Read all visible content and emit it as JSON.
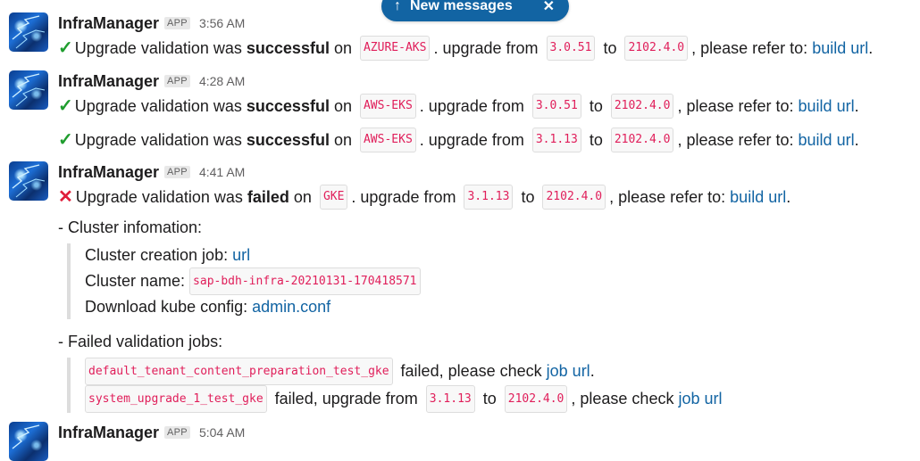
{
  "banner": {
    "label": "New messages",
    "arrow": "↑",
    "close": "✕"
  },
  "messages": [
    {
      "sender": "InfraManager",
      "badge": "APP",
      "time": "3:56 AM",
      "lines": [
        {
          "icon": "✓",
          "pre": "Upgrade validation was ",
          "bold": "successful",
          "on": " on ",
          "platform": "AZURE-AKS",
          "mid": ". upgrade from ",
          "from": "3.0.51",
          "to_word": " to ",
          "to": "2102.4.0",
          "post": ", please refer to: ",
          "link": "build url",
          "end": "."
        }
      ]
    },
    {
      "sender": "InfraManager",
      "badge": "APP",
      "time": "4:28 AM",
      "lines": [
        {
          "icon": "✓",
          "pre": "Upgrade validation was ",
          "bold": "successful",
          "on": " on ",
          "platform": "AWS-EKS",
          "mid": ". upgrade from ",
          "from": "3.0.51",
          "to_word": " to ",
          "to": "2102.4.0",
          "post": ", please refer to: ",
          "link": "build url",
          "end": "."
        },
        {
          "icon": "✓",
          "pre": "Upgrade validation was ",
          "bold": "successful",
          "on": " on ",
          "platform": "AWS-EKS",
          "mid": ". upgrade from ",
          "from": "3.1.13",
          "to_word": " to ",
          "to": "2102.4.0",
          "post": ", please refer to: ",
          "link": "build url",
          "end": "."
        }
      ]
    },
    {
      "sender": "InfraManager",
      "badge": "APP",
      "time": "4:41 AM",
      "lines": [
        {
          "icon": "✕",
          "pre": "Upgrade validation was ",
          "bold": "failed",
          "on": " on ",
          "platform": "GKE",
          "mid": ". upgrade from ",
          "from": "3.1.13",
          "to_word": " to ",
          "to": "2102.4.0",
          "post": ", please refer to: ",
          "link": "build url",
          "end": "."
        }
      ],
      "cluster_heading": "- Cluster infomation:",
      "cluster": {
        "job_label": "Cluster creation job: ",
        "job_link": "url",
        "name_label": "Cluster name: ",
        "name_value": "sap-bdh-infra-20210131-170418571",
        "config_label": "Download kube config: ",
        "config_link": "admin.conf"
      },
      "failed_heading": "- Failed validation jobs:",
      "failed_jobs": [
        {
          "job": "default_tenant_content_preparation_test_gke",
          "text": " failed, please check ",
          "link": "job url",
          "end": "."
        },
        {
          "job": "system_upgrade_1_test_gke",
          "text": " failed, upgrade from ",
          "from": "3.1.13",
          "to_word": " to ",
          "to": "2102.4.0",
          "text2": ", please check ",
          "link": "job url"
        }
      ]
    },
    {
      "sender": "InfraManager",
      "badge": "APP",
      "time": "5:04 AM"
    }
  ]
}
